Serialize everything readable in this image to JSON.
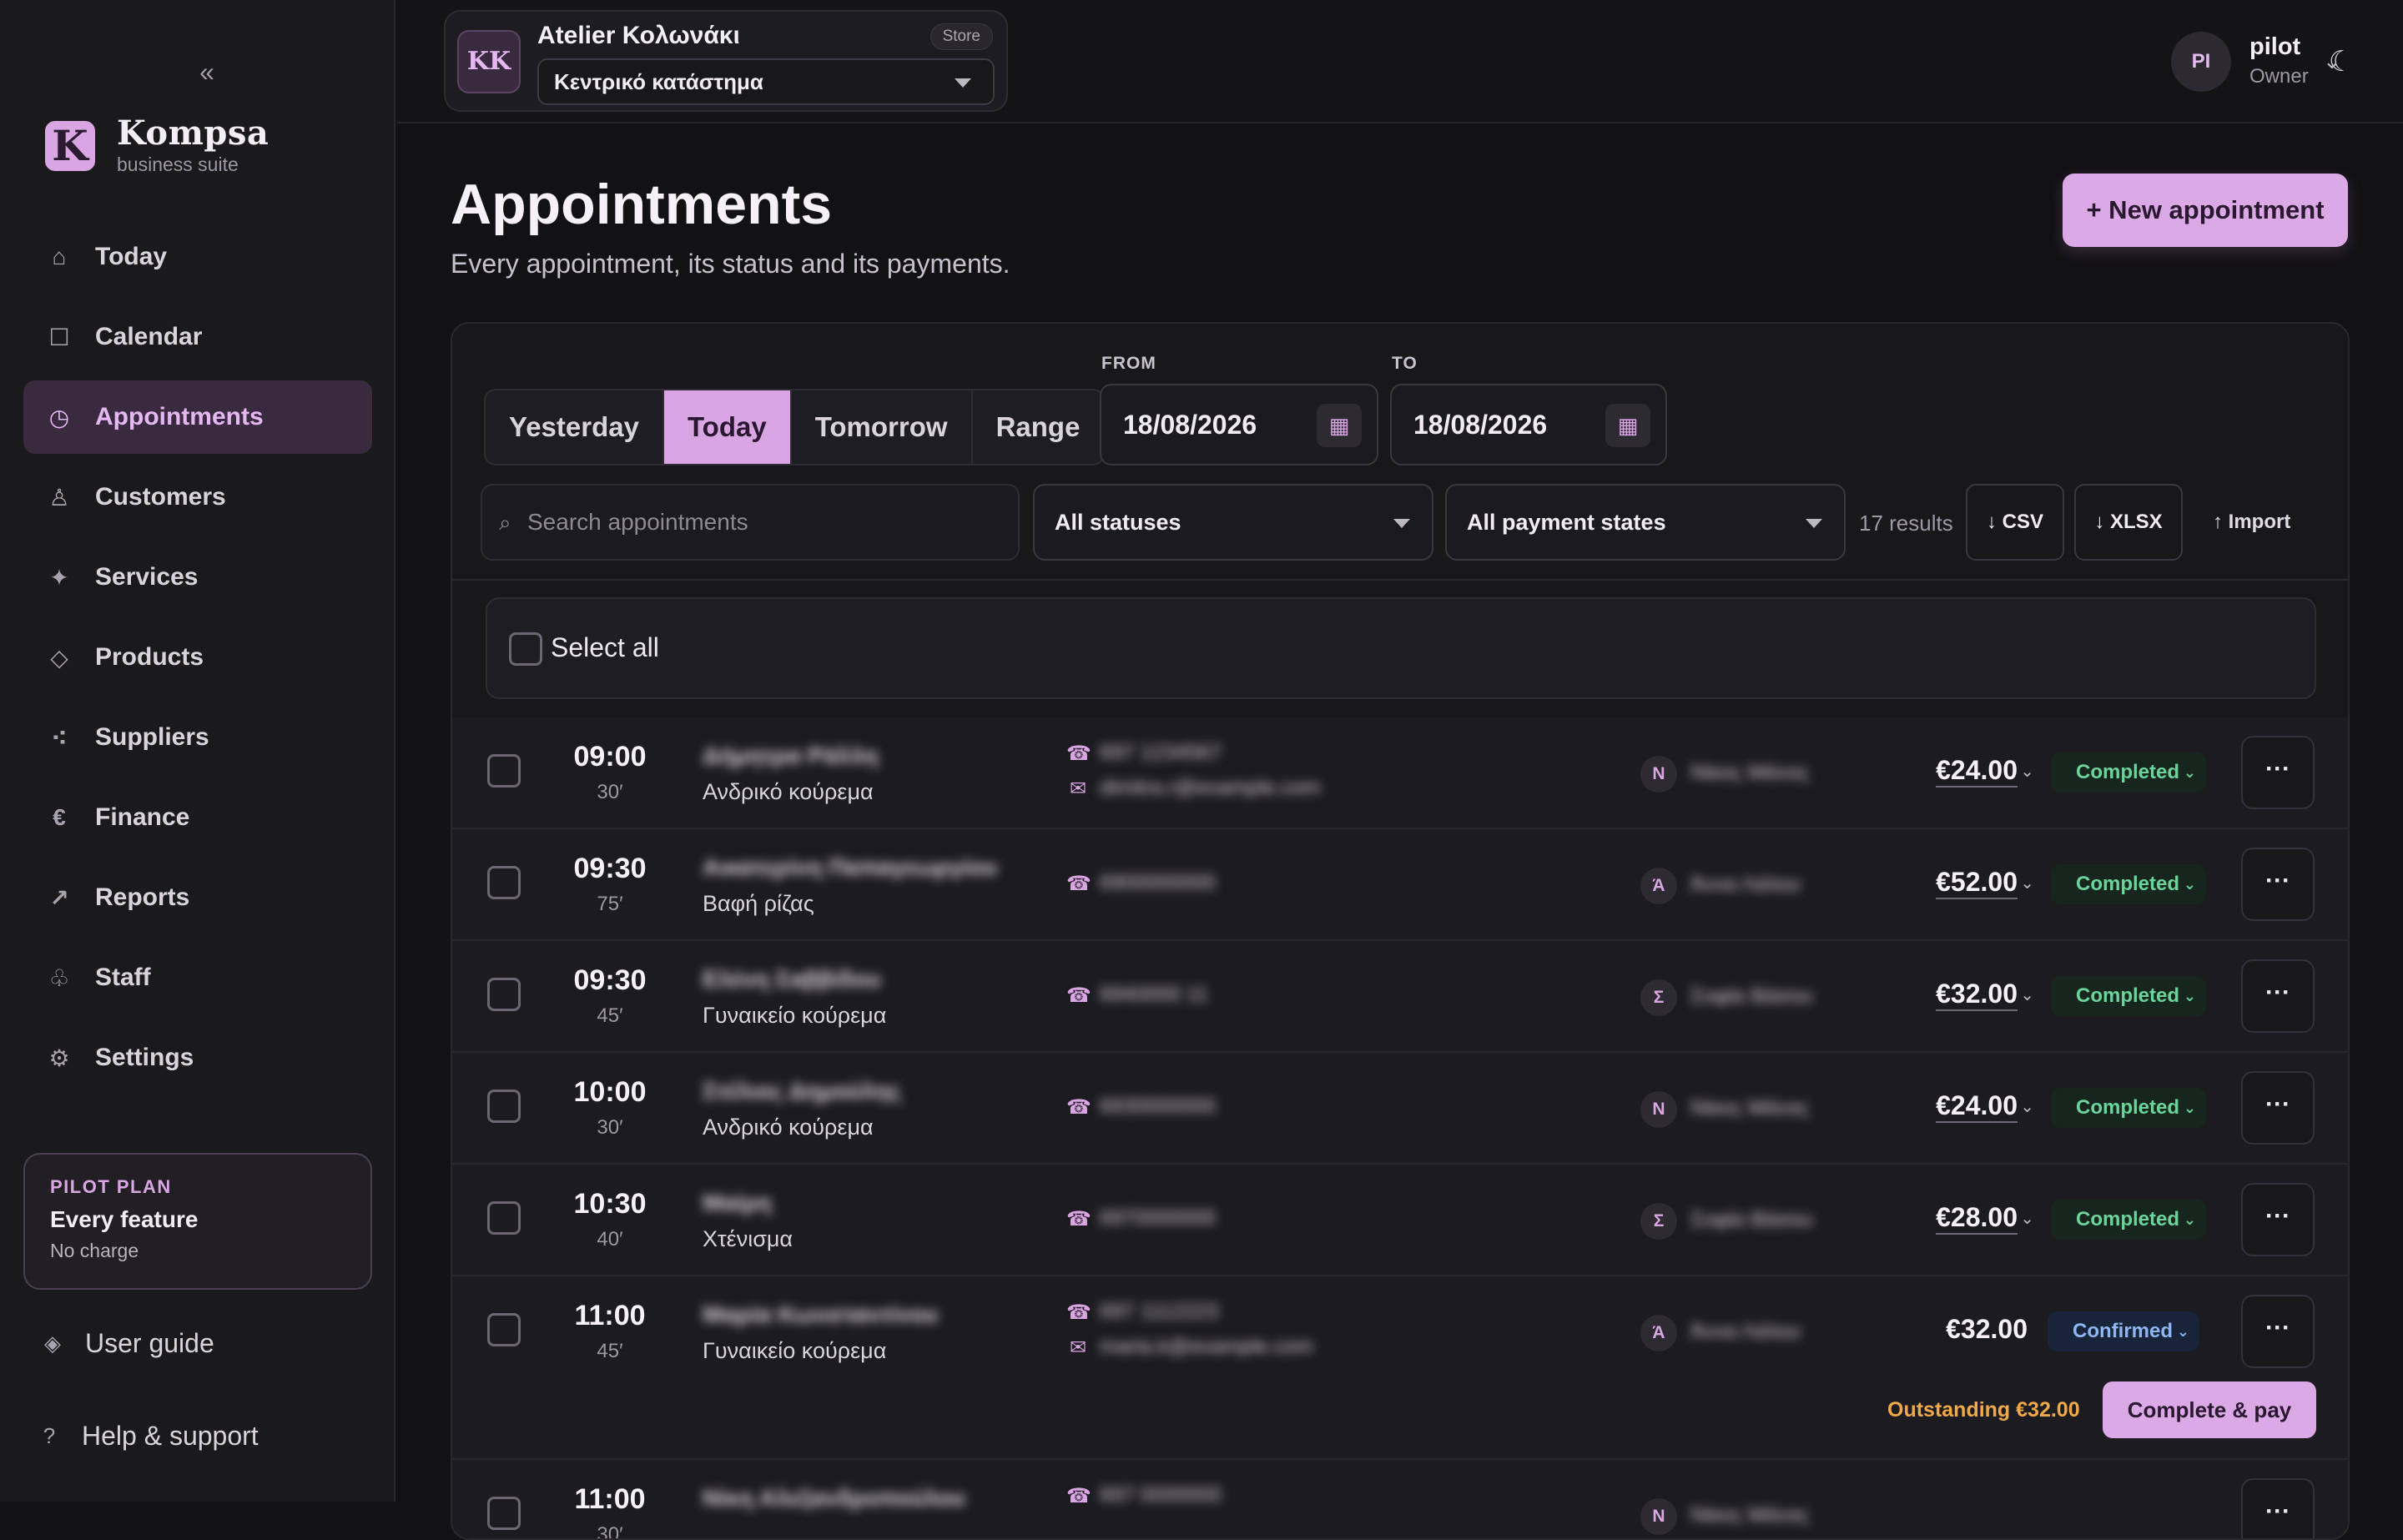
{
  "sidebar": {
    "collapse": "«",
    "brand": {
      "logo": "K",
      "name": "Kompsa",
      "sub": "business suite"
    },
    "items": [
      {
        "label": "Today",
        "icon": "⌂"
      },
      {
        "label": "Calendar",
        "icon": "☐"
      },
      {
        "label": "Appointments",
        "icon": "◷"
      },
      {
        "label": "Customers",
        "icon": "♙"
      },
      {
        "label": "Services",
        "icon": "✦"
      },
      {
        "label": "Products",
        "icon": "◇"
      },
      {
        "label": "Suppliers",
        "icon": "⁖"
      },
      {
        "label": "Finance",
        "icon": "€"
      },
      {
        "label": "Reports",
        "icon": "↗"
      },
      {
        "label": "Staff",
        "icon": "♧"
      },
      {
        "label": "Settings",
        "icon": "⚙"
      }
    ],
    "plan": {
      "label": "PILOT PLAN",
      "title": "Every feature",
      "sub": "No charge"
    },
    "user_guide": {
      "icon": "◈",
      "label": "User guide"
    },
    "help": {
      "icon": "?",
      "label": "Help & support"
    }
  },
  "topbar": {
    "store": {
      "initials": "KK",
      "name": "Atelier Κολωνάκι",
      "badge": "Store",
      "branch": "Κεντρικό κατάστημα"
    },
    "icons": {
      "theme": "☾",
      "search": "⌕",
      "diamond": "◊"
    },
    "user": {
      "initials": "PI",
      "name": "pilot",
      "role": "Owner",
      "caret": "⌄"
    }
  },
  "page": {
    "title": "Appointments",
    "subtitle": "Every appointment, its status and its payments.",
    "new_button": "+ New appointment"
  },
  "filters": {
    "segments": [
      "Yesterday",
      "Today",
      "Tomorrow",
      "Range"
    ],
    "from_label": "FROM",
    "from_value": "18/08/2026",
    "to_label": "TO",
    "to_value": "18/08/2026",
    "cal_icon": "▦",
    "search_icon": "⌕",
    "search_placeholder": "Search appointments",
    "status_filter": "All statuses",
    "payment_filter": "All payment states",
    "results": "17 results",
    "csv": "↓ CSV",
    "xlsx": "↓ XLSX",
    "import": "↑ Import"
  },
  "list": {
    "select_all": "Select all",
    "rows": [
      {
        "time": "09:00",
        "duration": "30′",
        "customer": "Δήμητρα Ράλλη",
        "service": "Ανδρικό κούρεμα",
        "phone": "697 1234567",
        "email": "dimitra.r@example.com",
        "staff_initial": "Ν",
        "staff": "Νίκος Μάνος",
        "price": "€24.00",
        "status": "Completed",
        "phone_icon": "☎",
        "mail_icon": "✉"
      },
      {
        "time": "09:30",
        "duration": "75′",
        "customer": "Αικατερίνη Παπαγεωργίου",
        "service": "Βαφή ρίζας",
        "phone": "6900000000",
        "staff_initial": "Ά",
        "staff": "Άννα Λάλου",
        "price": "€52.00",
        "status": "Completed",
        "phone_icon": "☎"
      },
      {
        "time": "09:30",
        "duration": "45′",
        "customer": "Ελένη Σαββίδου",
        "service": "Γυναικείο κούρεμα",
        "phone": "6940000 11",
        "staff_initial": "Σ",
        "staff": "Σοφία Βάσου",
        "price": "€32.00",
        "status": "Completed",
        "phone_icon": "☎"
      },
      {
        "time": "10:00",
        "duration": "30′",
        "customer": "Στέλιος Δημούλης",
        "service": "Ανδρικό κούρεμα",
        "phone": "6930000000",
        "staff_initial": "Ν",
        "staff": "Νίκος Μάνος",
        "price": "€24.00",
        "status": "Completed",
        "phone_icon": "☎"
      },
      {
        "time": "10:30",
        "duration": "40′",
        "customer": "Μαίρη",
        "service": "Χτένισμα",
        "phone": "6970000000",
        "staff_initial": "Σ",
        "staff": "Σοφία Βάσου",
        "price": "€28.00",
        "status": "Completed",
        "phone_icon": "☎"
      },
      {
        "time": "11:00",
        "duration": "45′",
        "customer": "Μαρία Κωνσταντίνου",
        "service": "Γυναικείο κούρεμα",
        "phone": "697 1112223",
        "email": "maria.k@example.com",
        "staff_initial": "Ά",
        "staff": "Άννα Λάλου",
        "price": "€32.00",
        "status": "Confirmed",
        "outstanding": "Outstanding €32.00",
        "complete_button": "Complete & pay",
        "phone_icon": "☎",
        "mail_icon": "✉"
      },
      {
        "time": "11:00",
        "duration": "30′",
        "customer": "Νίκη Αλεξανδροπούλου",
        "service": "",
        "phone": "697 0000000",
        "staff_initial": "Ν",
        "staff": "Νίκος Μάνος",
        "price": "",
        "status": "",
        "phone_icon": "☎"
      }
    ],
    "more_label": "···",
    "caret": "⌄"
  }
}
